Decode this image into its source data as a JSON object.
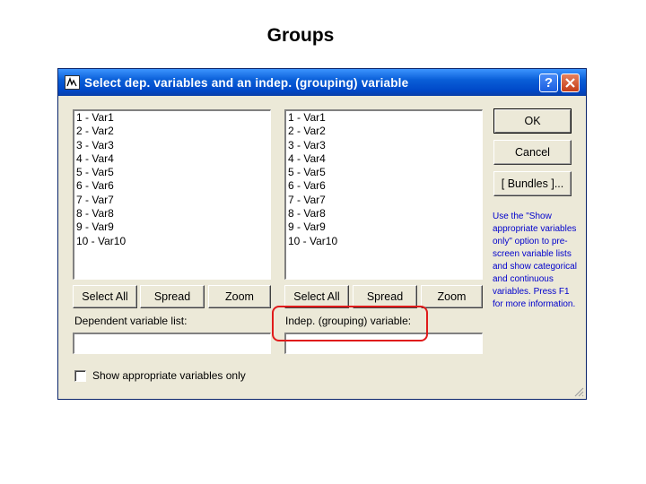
{
  "slide": {
    "title": "Groups"
  },
  "dialog": {
    "title": "Select dep. variables and an indep. (grouping) variable",
    "help_label": "?",
    "left_list": {
      "items": [
        "1 - Var1",
        "2 - Var2",
        "3 - Var3",
        "4 - Var4",
        "5 - Var5",
        "6 - Var6",
        "7 - Var7",
        "8 - Var8",
        "9 - Var9",
        "10 - Var10"
      ]
    },
    "right_list": {
      "items": [
        "1 - Var1",
        "2 - Var2",
        "3 - Var3",
        "4 - Var4",
        "5 - Var5",
        "6 - Var6",
        "7 - Var7",
        "8 - Var8",
        "9 - Var9",
        "10 - Var10"
      ]
    },
    "left_buttons": {
      "select_all": "Select All",
      "spread": "Spread",
      "zoom": "Zoom"
    },
    "right_buttons": {
      "select_all": "Select All",
      "spread": "Spread",
      "zoom": "Zoom"
    },
    "dependent_label": "Dependent variable list:",
    "dependent_value": "",
    "indep_label": "Indep. (grouping) variable:",
    "indep_value": "",
    "ok": "OK",
    "cancel": "Cancel",
    "bundles": "[ Bundles ]...",
    "help_text": "Use the \"Show appropriate variables only\" option to pre-screen variable lists and show categorical and continuous variables. Press F1 for more information.",
    "checkbox_label": "Show appropriate variables only",
    "checkbox_checked": false,
    "colors": {
      "titlebar": "#0a5fd8",
      "dialog_bg": "#ece9d8",
      "help_text": "#0000cc",
      "highlight": "#e01b1b"
    }
  }
}
